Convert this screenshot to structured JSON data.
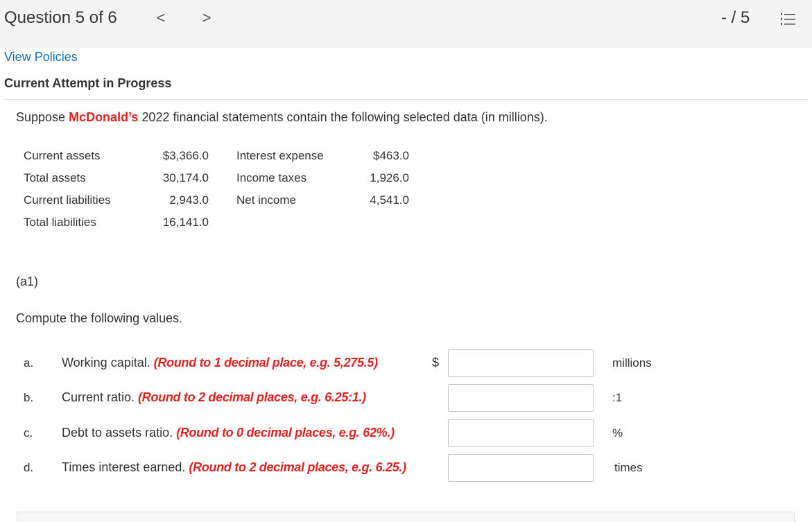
{
  "header": {
    "question_label": "Question 5 of 6",
    "prev_glyph": "<",
    "next_glyph": ">",
    "score": "- / 5",
    "list_icon": "list-icon"
  },
  "links": {
    "view_policies": "View Policies"
  },
  "attempt_label": "Current Attempt in Progress",
  "intro": {
    "prefix": "Suppose ",
    "company": "McDonald’s",
    "suffix": " 2022 financial statements contain the following selected data (in millions)."
  },
  "data_table": [
    {
      "label": "Current assets",
      "value": "$3,366.0",
      "label2": "Interest expense",
      "value2": "$463.0"
    },
    {
      "label": "Total assets",
      "value": "30,174.0",
      "label2": "Income taxes",
      "value2": "1,926.0"
    },
    {
      "label": "Current liabilities",
      "value": "2,943.0",
      "label2": "Net income",
      "value2": "4,541.0"
    },
    {
      "label": "Total liabilities",
      "value": "16,141.0",
      "label2": "",
      "value2": ""
    }
  ],
  "section_label": "(a1)",
  "compute_text": "Compute the following values.",
  "questions": [
    {
      "letter": "a.",
      "text": "Working capital. ",
      "hint": "(Round to 1 decimal place, e.g. 5,275.5)",
      "prefix": "$",
      "unit": "millions",
      "value": ""
    },
    {
      "letter": "b.",
      "text": "Current ratio. ",
      "hint": "(Round to 2 decimal places, e.g. 6.25:1.)",
      "prefix": "",
      "unit": ":1",
      "value": ""
    },
    {
      "letter": "c.",
      "text": "Debt to assets ratio. ",
      "hint": "(Round to 0 decimal places, e.g. 62%.)",
      "prefix": "",
      "unit": "%",
      "value": ""
    },
    {
      "letter": "d.",
      "text": "Times interest earned. ",
      "hint": "(Round to 2 decimal places, e.g. 6.25.)",
      "prefix": "",
      "unit": "times",
      "value": ""
    }
  ],
  "colors": {
    "accent_red": "#e02424",
    "link_blue": "#1a6fb5",
    "topbar_bg": "#f4f4f4"
  }
}
